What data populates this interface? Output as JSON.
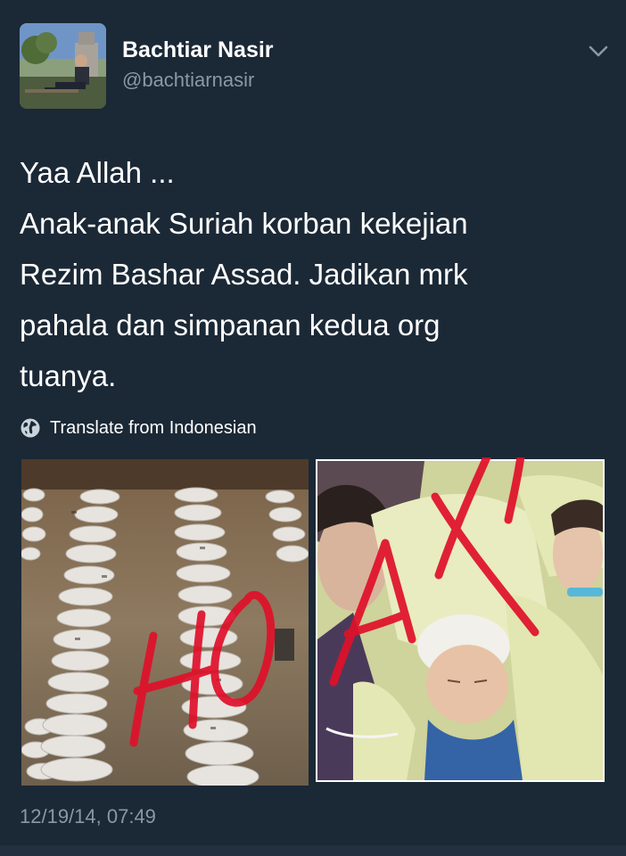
{
  "tweet": {
    "author": {
      "name": "Bachtiar Nasir",
      "handle": "@bachtiarnasir"
    },
    "text_lines": [
      "Yaa Allah ...",
      "Anak-anak Suriah korban kekejian",
      "Rezim Bashar Assad. Jadikan mrk",
      "pahala dan simpanan kedua org",
      "tuanya."
    ],
    "translate_label": "Translate from Indonesian",
    "timestamp": "12/19/14, 07:49",
    "media": {
      "overlay_text": "HOAX"
    }
  },
  "colors": {
    "background": "#1b2836",
    "text_primary": "#ffffff",
    "text_secondary": "#8899a6",
    "overlay_red": "#e0102a"
  },
  "icons": {
    "chevron": "chevron-down-icon",
    "globe": "globe-icon"
  }
}
